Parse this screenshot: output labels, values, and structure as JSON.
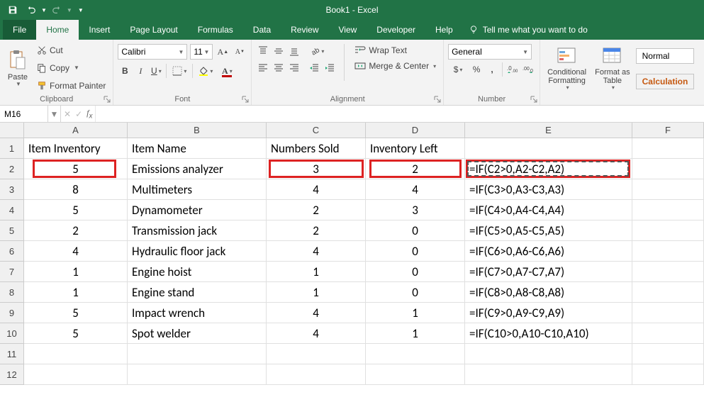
{
  "title": "Book1  -  Excel",
  "tabs": [
    "File",
    "Home",
    "Insert",
    "Page Layout",
    "Formulas",
    "Data",
    "Review",
    "View",
    "Developer",
    "Help"
  ],
  "tellme": "Tell me what you want to do",
  "clipboard": {
    "paste": "Paste",
    "cut": "Cut",
    "copy": "Copy",
    "fp": "Format Painter",
    "label": "Clipboard"
  },
  "font": {
    "name": "Calibri",
    "size": "11",
    "label": "Font"
  },
  "alignment": {
    "wrap": "Wrap Text",
    "merge": "Merge & Center",
    "label": "Alignment"
  },
  "number": {
    "format": "General",
    "label": "Number"
  },
  "styles": {
    "cond": "Conditional\nFormatting",
    "table": "Format as\nTable",
    "normal": "Normal",
    "calc": "Calculation"
  },
  "namebox": "M16",
  "columns": [
    "A",
    "B",
    "C",
    "D",
    "E",
    "F"
  ],
  "headers": {
    "A": "Item Inventory",
    "B": "Item Name",
    "C": "Numbers Sold",
    "D": "Inventory Left"
  },
  "rows": [
    {
      "A": "5",
      "B": "Emissions analyzer",
      "C": "3",
      "D": "2",
      "E": "=IF(C2>0,A2-C2,A2)"
    },
    {
      "A": "8",
      "B": "Multimeters",
      "C": "4",
      "D": "4",
      "E": "=IF(C3>0,A3-C3,A3)"
    },
    {
      "A": "5",
      "B": "Dynamometer",
      "C": "2",
      "D": "3",
      "E": "=IF(C4>0,A4-C4,A4)"
    },
    {
      "A": "2",
      "B": "Transmission jack",
      "C": "2",
      "D": "0",
      "E": "=IF(C5>0,A5-C5,A5)"
    },
    {
      "A": "4",
      "B": "Hydraulic floor jack",
      "C": "4",
      "D": "0",
      "E": "=IF(C6>0,A6-C6,A6)"
    },
    {
      "A": "1",
      "B": "Engine hoist",
      "C": "1",
      "D": "0",
      "E": "=IF(C7>0,A7-C7,A7)"
    },
    {
      "A": "1",
      "B": "Engine stand",
      "C": "1",
      "D": "0",
      "E": "=IF(C8>0,A8-C8,A8)"
    },
    {
      "A": "5",
      "B": "Impact wrench",
      "C": "4",
      "D": "1",
      "E": "=IF(C9>0,A9-C9,A9)"
    },
    {
      "A": "5",
      "B": "Spot welder",
      "C": "4",
      "D": "1",
      "E": "=IF(C10>0,A10-C10,A10)"
    }
  ]
}
